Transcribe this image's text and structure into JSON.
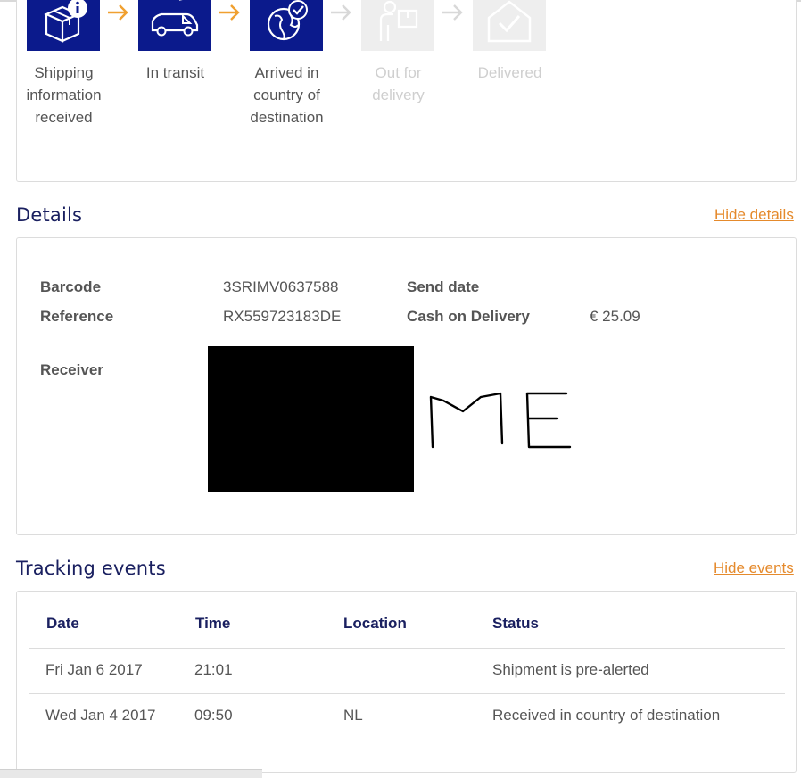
{
  "progress": {
    "steps": [
      {
        "label": "Shipping\ninformation\nreceived",
        "icon": "box-info-icon",
        "done": true
      },
      {
        "label": "In transit",
        "icon": "van-icon",
        "done": true
      },
      {
        "label": "Arrived in\ncountry of\ndestination",
        "icon": "globe-check-icon",
        "done": true
      },
      {
        "label": "Out for\ndelivery",
        "icon": "person-package-icon",
        "done": false
      },
      {
        "label": "Delivered",
        "icon": "house-check-icon",
        "done": false
      }
    ],
    "colors": {
      "done_bg": "#0b1a8c",
      "arrow_done": "#f0a030",
      "arrow_todo": "#d8d8d8",
      "todo_bg": "#eeeeee"
    }
  },
  "details": {
    "heading": "Details",
    "hide_link": "Hide details",
    "barcode_label": "Barcode",
    "barcode_value": "3SRIMV0637588",
    "reference_label": "Reference",
    "reference_value": "RX559723183DE",
    "send_date_label": "Send date",
    "cod_label": "Cash on Delivery",
    "cod_value": "€ 25.09",
    "receiver_label": "Receiver",
    "receiver_handwriting": "ME"
  },
  "events": {
    "heading": "Tracking events",
    "hide_link": "Hide events",
    "columns": [
      "Date",
      "Time",
      "Location",
      "Status"
    ],
    "rows": [
      {
        "date": "Fri Jan 6 2017",
        "time": "21:01",
        "location": "",
        "status": "Shipment is pre-alerted"
      },
      {
        "date": "Wed Jan 4 2017",
        "time": "09:50",
        "location": "NL",
        "status": "Received in country of destination"
      }
    ]
  },
  "accent_color": "#e58a2c",
  "heading_color": "#1a2060"
}
